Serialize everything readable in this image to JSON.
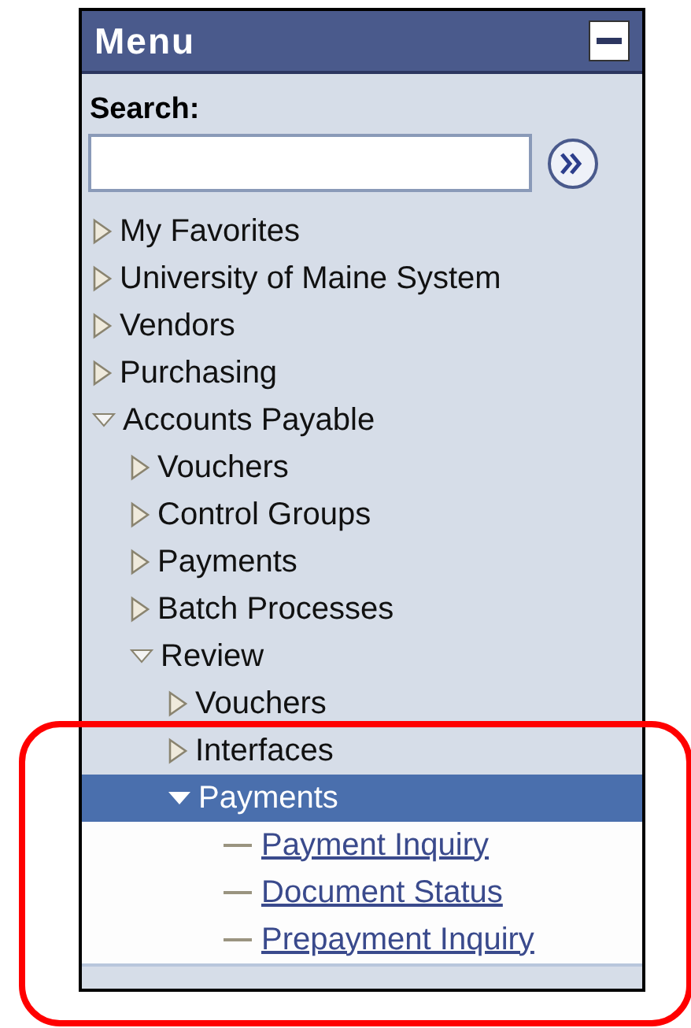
{
  "menu": {
    "title": "Menu",
    "search": {
      "label": "Search:"
    },
    "tree": [
      {
        "kind": "folder",
        "label": "My Favorites",
        "expanded": false,
        "selected": false
      },
      {
        "kind": "folder",
        "label": "University of Maine System",
        "expanded": false,
        "selected": false
      },
      {
        "kind": "folder",
        "label": "Vendors",
        "expanded": false,
        "selected": false
      },
      {
        "kind": "folder",
        "label": "Purchasing",
        "expanded": false,
        "selected": false
      },
      {
        "kind": "folder",
        "label": "Accounts Payable",
        "expanded": true,
        "selected": false,
        "children": [
          {
            "kind": "folder",
            "label": "Vouchers",
            "expanded": false,
            "selected": false
          },
          {
            "kind": "folder",
            "label": "Control Groups",
            "expanded": false,
            "selected": false
          },
          {
            "kind": "folder",
            "label": "Payments",
            "expanded": false,
            "selected": false
          },
          {
            "kind": "folder",
            "label": "Batch Processes",
            "expanded": false,
            "selected": false
          },
          {
            "kind": "folder",
            "label": "Review",
            "expanded": true,
            "selected": false,
            "children": [
              {
                "kind": "folder",
                "label": "Vouchers",
                "expanded": false,
                "selected": false
              },
              {
                "kind": "folder",
                "label": "Interfaces",
                "expanded": false,
                "selected": false
              },
              {
                "kind": "folder",
                "label": "Payments",
                "expanded": true,
                "selected": true,
                "children": [
                  {
                    "kind": "link",
                    "label": "Payment Inquiry",
                    "selected": false
                  },
                  {
                    "kind": "link",
                    "label": "Document Status",
                    "selected": false
                  },
                  {
                    "kind": "link",
                    "label": "Prepayment Inquiry",
                    "selected": false
                  }
                ]
              }
            ]
          }
        ]
      }
    ]
  }
}
